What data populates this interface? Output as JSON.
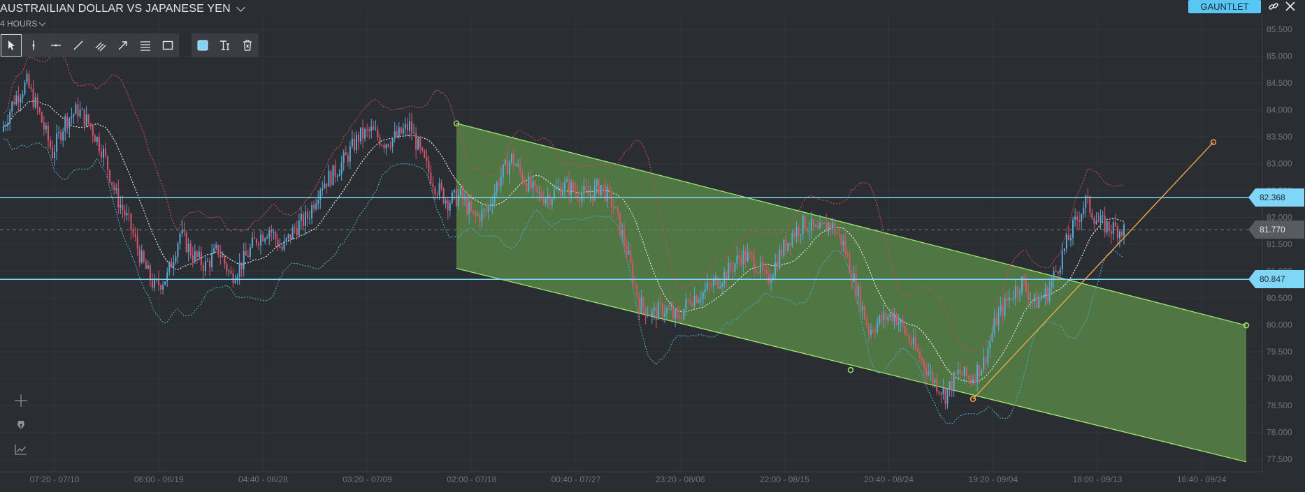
{
  "header": {
    "title": "AUSTRAILIAN DOLLAR VS JAPANESE YEN",
    "interval": "4 HOURS",
    "gauntlet_label": "GAUNTLET"
  },
  "toolbar": {
    "draw_tools": [
      "pointer-icon",
      "vertical-line-icon",
      "horizontal-line-icon",
      "trend-line-icon",
      "parallel-channel-icon",
      "arrow-icon",
      "fibonacci-icon",
      "rectangle-icon"
    ],
    "style_tools": [
      "fill-color-swatch",
      "text-tool-icon",
      "delete-drawing-icon"
    ],
    "fill_color": "#7fd6f6"
  },
  "side_tools": [
    "crosshair-icon",
    "pen-icon",
    "indicator-icon"
  ],
  "price_tags": [
    {
      "label": "82.368",
      "value": 82.368,
      "style": "line"
    },
    {
      "label": "81.770",
      "value": 81.77,
      "style": "current"
    },
    {
      "label": "80.847",
      "value": 80.847,
      "style": "line"
    }
  ],
  "colors": {
    "background": "#2a2d32",
    "grid": "#32363c",
    "candle_up": "#5aa9d6",
    "candle_down": "#d9556f",
    "upper_band": "#c44a5e",
    "lower_band": "#4aa6c9",
    "middle_band": "#e8e8e8",
    "horizontal_lines": "#7fd6f6",
    "channel_fill": "#5a8a48",
    "channel_line": "#9fe870",
    "trend_line": "#f0a64a"
  },
  "chart_data": {
    "type": "candlestick",
    "y_axis": {
      "ticks": [
        85.5,
        85.0,
        84.5,
        84.0,
        83.5,
        83.0,
        82.5,
        82.0,
        81.5,
        81.0,
        80.5,
        80.0,
        79.5,
        79.0,
        78.5,
        78.0,
        77.5
      ],
      "tick_labels": [
        "85.500",
        "85.000",
        "84.500",
        "84.000",
        "83.500",
        "83.000",
        "82.500",
        "82.000",
        "81.500",
        "81.000",
        "80.500",
        "80.000",
        "79.500",
        "79.000",
        "78.500",
        "78.000",
        "77.500"
      ],
      "range": [
        77.3,
        85.8
      ]
    },
    "x_axis": {
      "tick_labels": [
        "07:20 - 07/10",
        "06:00 - 06/19",
        "04:40 - 06/28",
        "03:20 - 07/09",
        "02:00 - 07/18",
        "00:40 - 07/27",
        "23:20 - 08/06",
        "22:00 - 08/15",
        "20:40 - 08/24",
        "19:20 - 09/04",
        "18:00 - 09/13",
        "16:40 - 09/24"
      ]
    },
    "price_path": [
      [
        0,
        83.6
      ],
      [
        2,
        84.2
      ],
      [
        4,
        84.5
      ],
      [
        6,
        83.9
      ],
      [
        8,
        83.2
      ],
      [
        10,
        83.8
      ],
      [
        12,
        84.0
      ],
      [
        14,
        83.7
      ],
      [
        16,
        83.2
      ],
      [
        18,
        82.4
      ],
      [
        20,
        81.9
      ],
      [
        22,
        81.2
      ],
      [
        24,
        80.7
      ],
      [
        26,
        80.9
      ],
      [
        28,
        81.7
      ],
      [
        30,
        81.3
      ],
      [
        32,
        81.1
      ],
      [
        34,
        81.4
      ],
      [
        36,
        80.9
      ],
      [
        38,
        81.2
      ],
      [
        40,
        81.6
      ],
      [
        42,
        81.8
      ],
      [
        44,
        81.4
      ],
      [
        46,
        81.8
      ],
      [
        48,
        82.0
      ],
      [
        50,
        82.6
      ],
      [
        52,
        82.8
      ],
      [
        54,
        83.1
      ],
      [
        56,
        83.5
      ],
      [
        58,
        83.6
      ],
      [
        60,
        83.4
      ],
      [
        62,
        83.5
      ],
      [
        64,
        83.7
      ],
      [
        66,
        83.1
      ],
      [
        68,
        82.6
      ],
      [
        70,
        82.3
      ],
      [
        72,
        82.4
      ],
      [
        74,
        82.0
      ],
      [
        76,
        82.1
      ],
      [
        78,
        82.7
      ],
      [
        80,
        83.1
      ],
      [
        82,
        82.7
      ],
      [
        84,
        82.4
      ],
      [
        86,
        82.4
      ],
      [
        88,
        82.6
      ],
      [
        90,
        82.5
      ],
      [
        92,
        82.4
      ],
      [
        94,
        82.6
      ],
      [
        96,
        82.2
      ],
      [
        98,
        81.4
      ],
      [
        100,
        80.4
      ],
      [
        102,
        80.2
      ],
      [
        104,
        80.3
      ],
      [
        106,
        80.1
      ],
      [
        108,
        80.5
      ],
      [
        110,
        80.6
      ],
      [
        112,
        80.8
      ],
      [
        114,
        81.0
      ],
      [
        116,
        81.3
      ],
      [
        118,
        81.2
      ],
      [
        120,
        80.8
      ],
      [
        122,
        81.3
      ],
      [
        124,
        81.7
      ],
      [
        126,
        81.9
      ],
      [
        128,
        81.7
      ],
      [
        130,
        81.9
      ],
      [
        132,
        81.5
      ],
      [
        134,
        80.7
      ],
      [
        136,
        79.9
      ],
      [
        138,
        80.1
      ],
      [
        140,
        80.2
      ],
      [
        142,
        79.8
      ],
      [
        144,
        79.4
      ],
      [
        146,
        79.0
      ],
      [
        148,
        78.7
      ],
      [
        150,
        79.1
      ],
      [
        152,
        79.0
      ],
      [
        154,
        79.3
      ],
      [
        156,
        80.1
      ],
      [
        158,
        80.5
      ],
      [
        160,
        80.8
      ],
      [
        162,
        80.4
      ],
      [
        164,
        80.6
      ],
      [
        166,
        81.2
      ],
      [
        168,
        81.8
      ],
      [
        170,
        82.3
      ],
      [
        172,
        81.9
      ],
      [
        174,
        81.8
      ],
      [
        176,
        81.77
      ]
    ]
  }
}
